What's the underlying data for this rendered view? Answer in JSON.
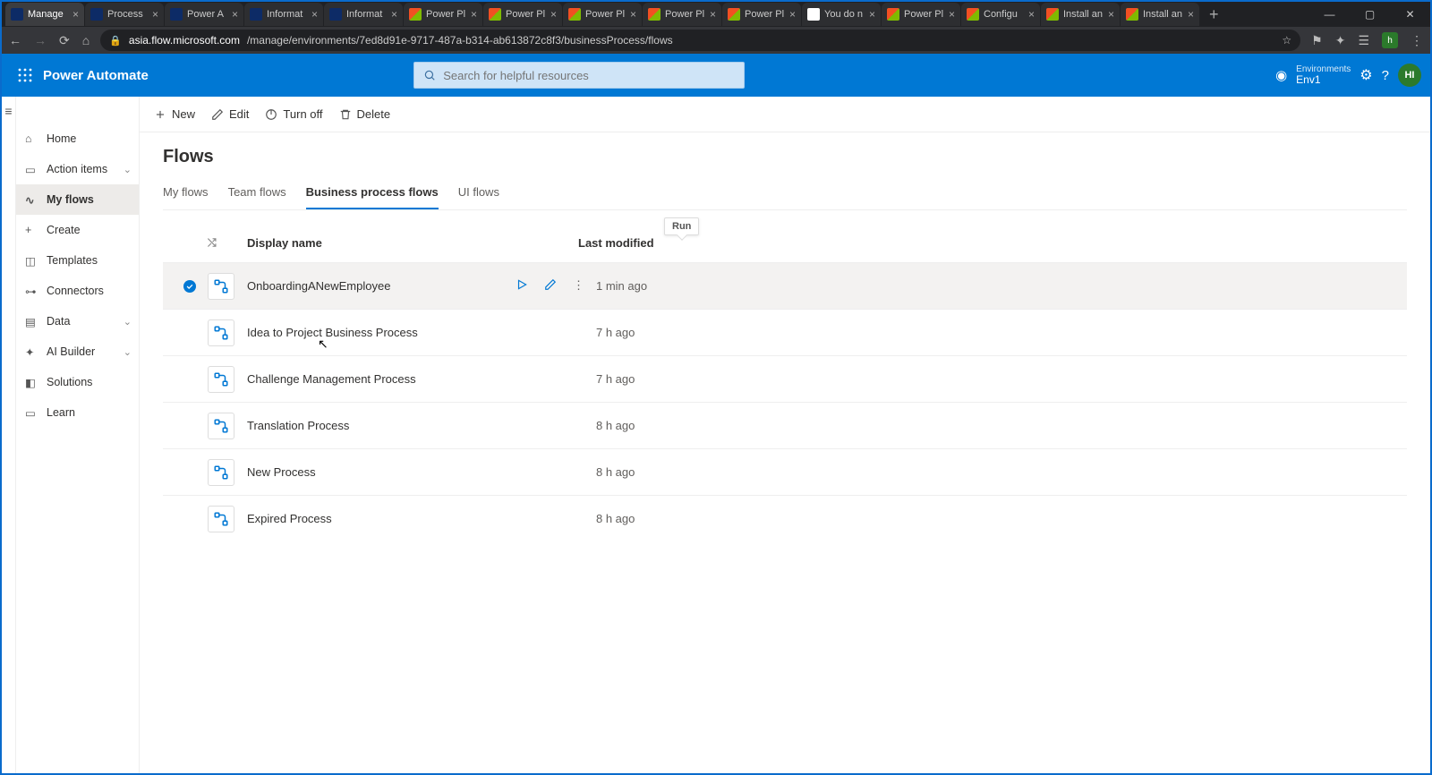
{
  "browser": {
    "tabs": [
      {
        "label": "Manage",
        "kind": "pa",
        "active": true
      },
      {
        "label": "Process",
        "kind": "pa"
      },
      {
        "label": "Power A",
        "kind": "pa"
      },
      {
        "label": "Informat",
        "kind": "pa"
      },
      {
        "label": "Informat",
        "kind": "pa"
      },
      {
        "label": "Power Pl",
        "kind": "ms"
      },
      {
        "label": "Power Pl",
        "kind": "ms"
      },
      {
        "label": "Power Pl",
        "kind": "ms"
      },
      {
        "label": "Power Pl",
        "kind": "ms"
      },
      {
        "label": "Power Pl",
        "kind": "ms"
      },
      {
        "label": "You do n",
        "kind": "g"
      },
      {
        "label": "Power Pl",
        "kind": "ms"
      },
      {
        "label": "Configu",
        "kind": "ms"
      },
      {
        "label": "Install an",
        "kind": "ms"
      },
      {
        "label": "Install an",
        "kind": "ms"
      }
    ],
    "url_host": "asia.flow.microsoft.com",
    "url_path": "/manage/environments/7ed8d91e-9717-487a-b314-ab613872c8f3/businessProcess/flows",
    "profile_letter": "h"
  },
  "app": {
    "brand": "Power Automate",
    "search_placeholder": "Search for helpful resources",
    "env_label": "Environments",
    "env_value": "Env1",
    "avatar": "HI"
  },
  "leftnav": {
    "items": [
      {
        "label": "Home",
        "icon": "home"
      },
      {
        "label": "Action items",
        "icon": "clipboard",
        "chev": true
      },
      {
        "label": "My flows",
        "icon": "flow",
        "active": true
      },
      {
        "label": "Create",
        "icon": "plus"
      },
      {
        "label": "Templates",
        "icon": "template"
      },
      {
        "label": "Connectors",
        "icon": "connector"
      },
      {
        "label": "Data",
        "icon": "data",
        "chev": true
      },
      {
        "label": "AI Builder",
        "icon": "ai",
        "chev": true
      },
      {
        "label": "Solutions",
        "icon": "solutions"
      },
      {
        "label": "Learn",
        "icon": "learn"
      }
    ]
  },
  "cmdbar": {
    "new": "New",
    "edit": "Edit",
    "turnoff": "Turn off",
    "delete": "Delete"
  },
  "page": {
    "title": "Flows",
    "tabs": [
      {
        "label": "My flows"
      },
      {
        "label": "Team flows"
      },
      {
        "label": "Business process flows",
        "active": true
      },
      {
        "label": "UI flows"
      }
    ],
    "tooltip": "Run",
    "columns": {
      "name": "Display name",
      "modified": "Last modified"
    },
    "rows": [
      {
        "name": "OnboardingANewEmployee",
        "modified": "1 min ago",
        "selected": true,
        "actions": true
      },
      {
        "name": "Idea to Project Business Process",
        "modified": "7 h ago"
      },
      {
        "name": "Challenge Management Process",
        "modified": "7 h ago"
      },
      {
        "name": "Translation Process",
        "modified": "8 h ago"
      },
      {
        "name": "New Process",
        "modified": "8 h ago"
      },
      {
        "name": "Expired Process",
        "modified": "8 h ago"
      }
    ]
  }
}
